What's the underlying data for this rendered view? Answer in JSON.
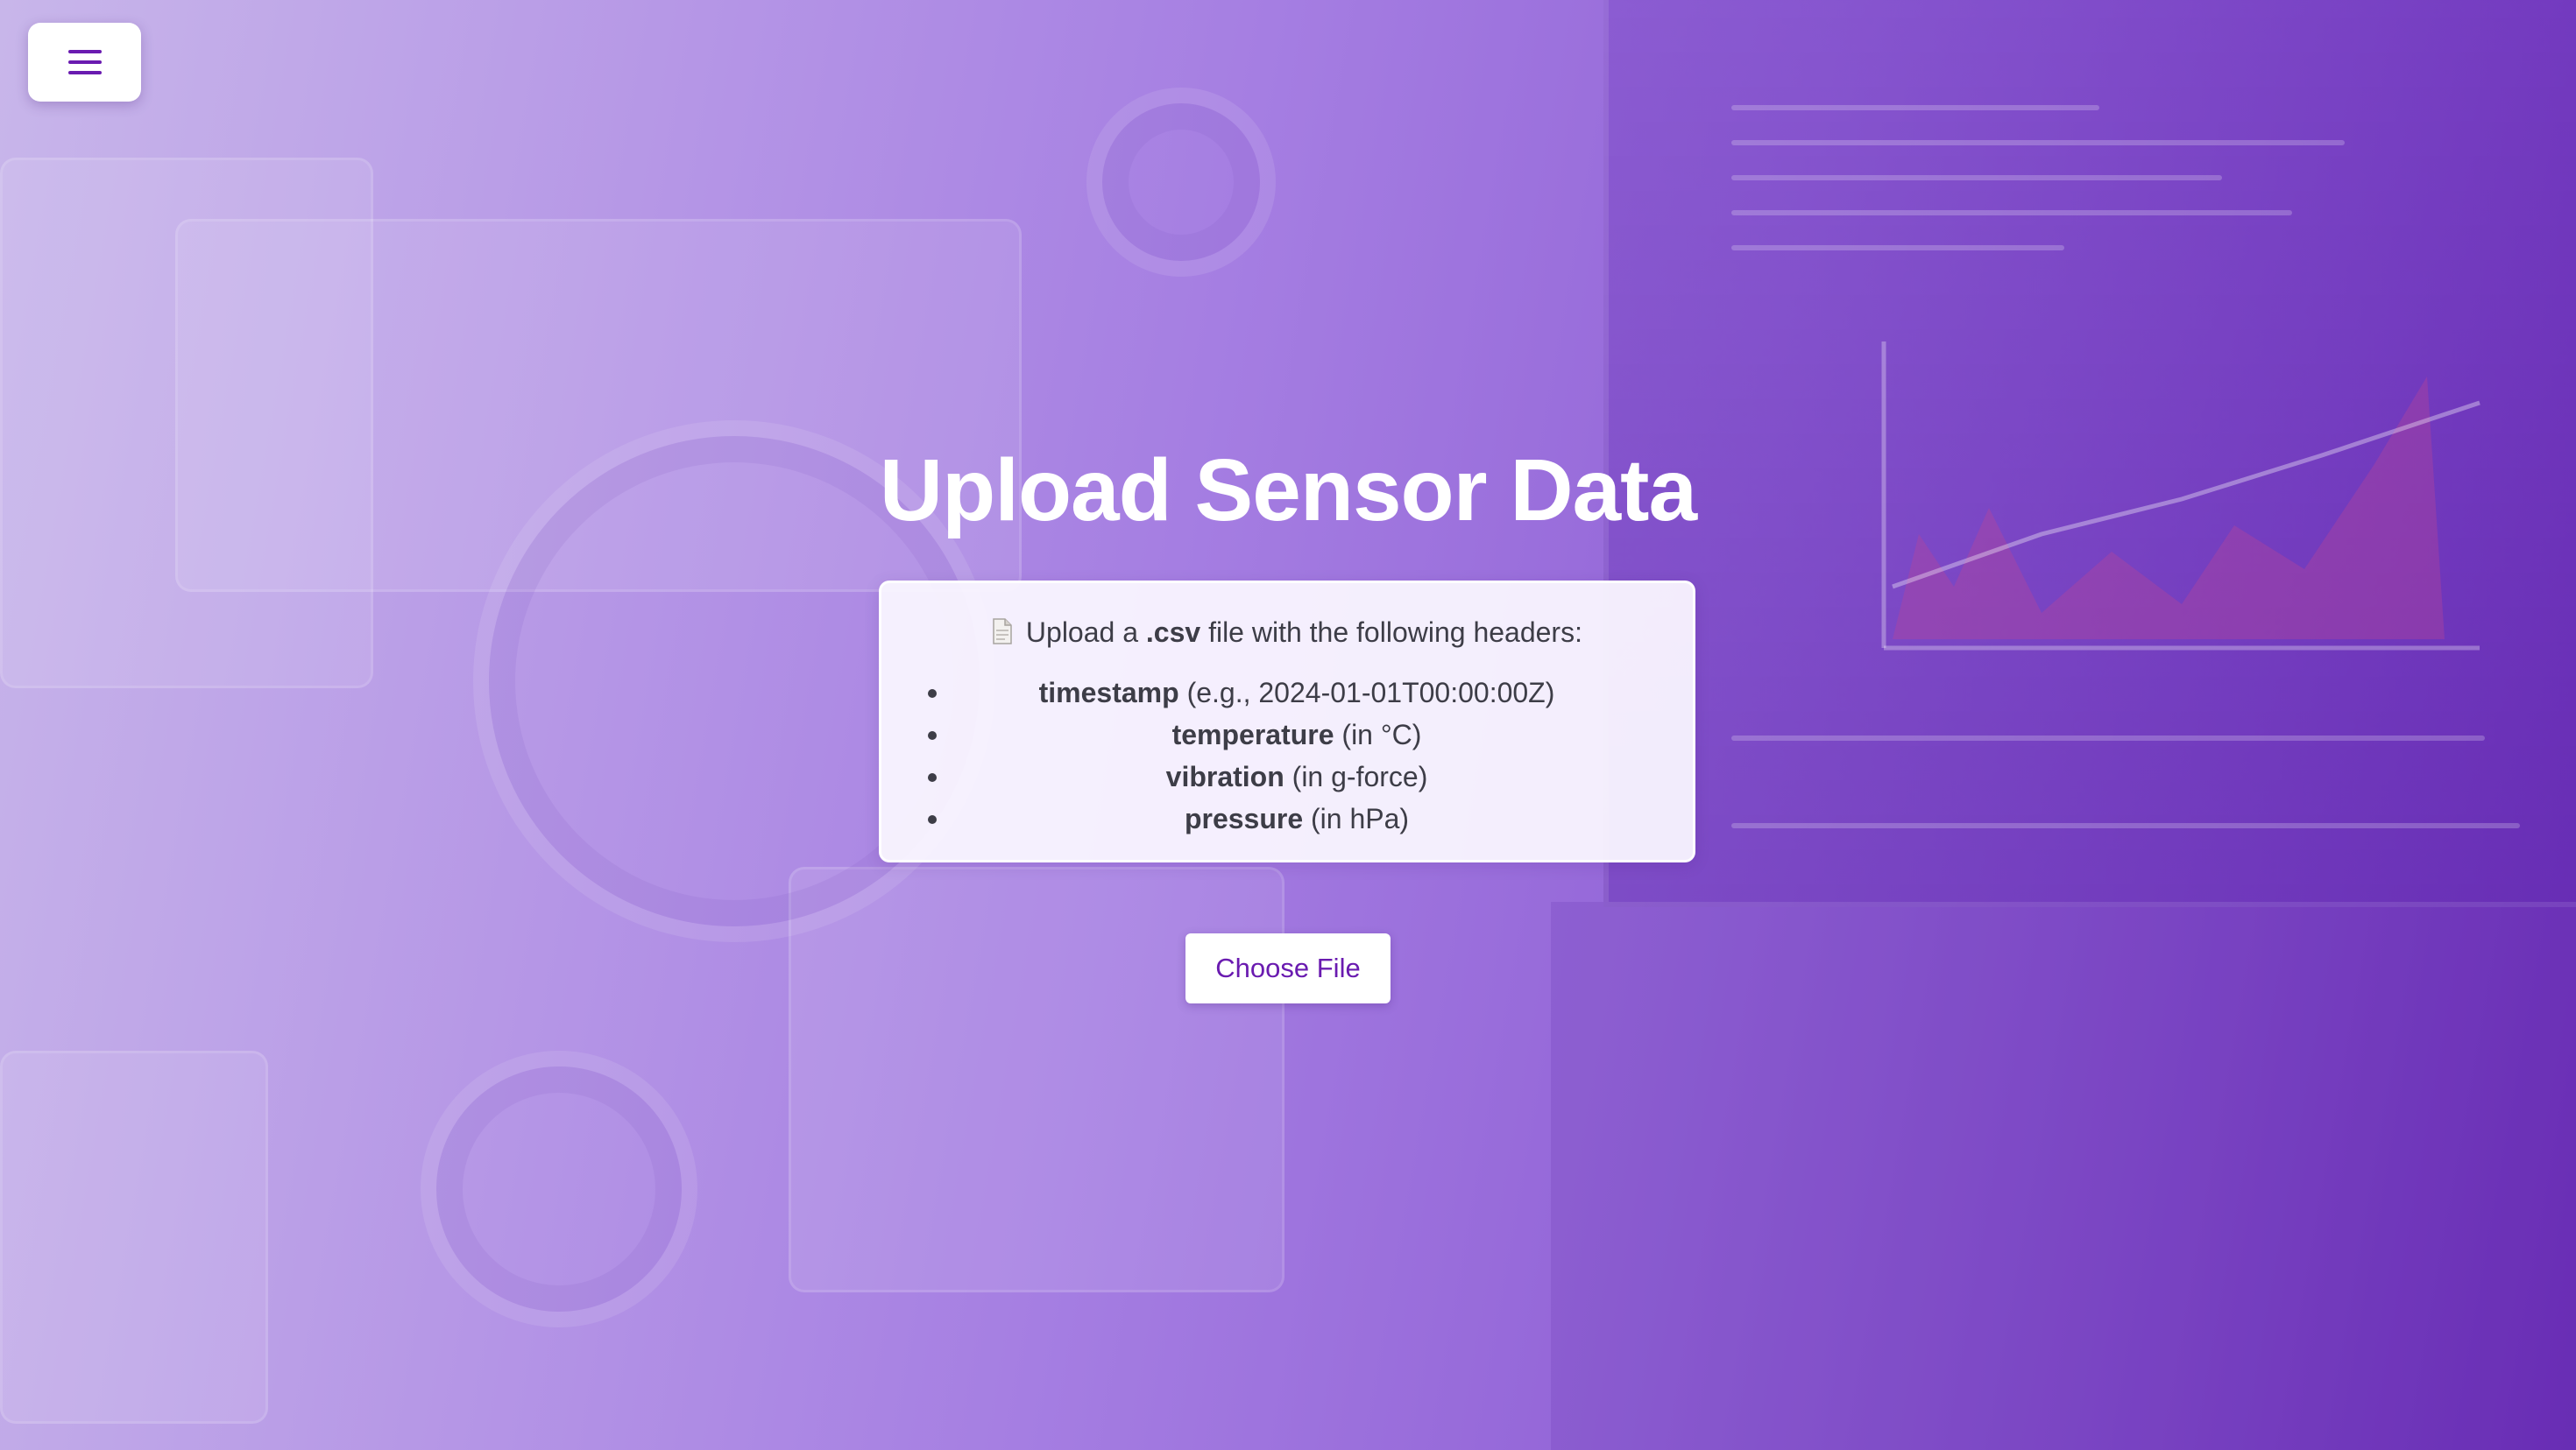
{
  "menu": {
    "icon": "hamburger-menu-icon",
    "accent_color": "#6a1bb0"
  },
  "page": {
    "title": "Upload Sensor Data"
  },
  "instructions": {
    "icon": "document-icon",
    "intro_prefix": "Upload a",
    "intro_format": ".csv",
    "intro_suffix": "file with the following headers:",
    "headers": [
      {
        "name": "timestamp",
        "detail": "(e.g., 2024-01-01T00:00:00Z)"
      },
      {
        "name": "temperature",
        "detail": "(in °C)"
      },
      {
        "name": "vibration",
        "detail": "(in g-force)"
      },
      {
        "name": "pressure",
        "detail": "(in hPa)"
      }
    ]
  },
  "upload": {
    "button_label": "Choose File"
  },
  "colors": {
    "background_start": "#c8b6ea",
    "background_end": "#6a2cb6",
    "button_text": "#6a1bb0",
    "card_text": "#3d3d47"
  }
}
